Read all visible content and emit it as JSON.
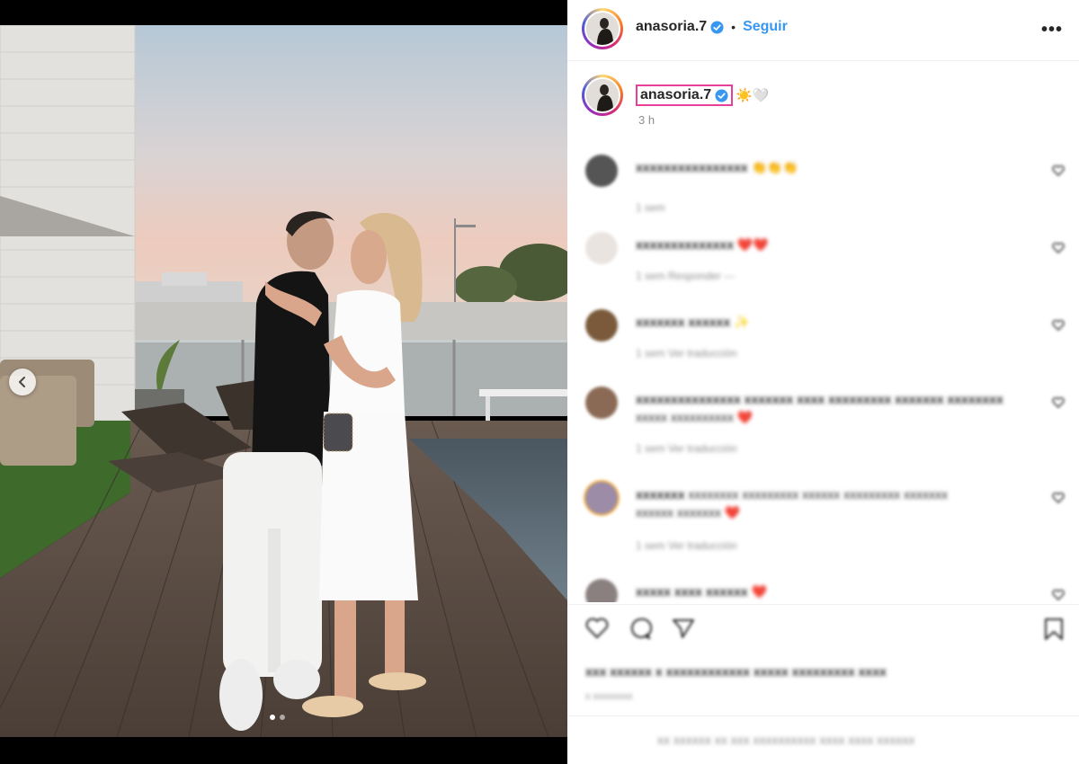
{
  "post": {
    "author": "anasoria.7",
    "follow_label": "Seguir",
    "separator": "•",
    "more_label": "•••",
    "caption_emoji": "☀️🤍",
    "time_ago": "3 h",
    "carousel": {
      "total": 2,
      "active_index": 0
    }
  },
  "comments": [
    {
      "user": "xxxxxxxxxxxxxxxx",
      "text": "",
      "emoji": "👏👏👏",
      "meta": "1 sem",
      "avatar_color": "#555555"
    },
    {
      "user": "xxxxxxxxxxxxxx",
      "text": "",
      "emoji": "❤️❤️",
      "meta": "1 sem  Responder  ---",
      "avatar_color": "#c9c4c0"
    },
    {
      "user": "xxxxxxx  xxxxxx",
      "text": "",
      "emoji": "✨",
      "meta": "1 sem  Ver traducción",
      "avatar_color": "#7a5a3a"
    },
    {
      "user": "xxxxxxxxxxxxxxx xxxxxxx xxxx xxxxxxxxx xxxxxxx xxxxxxxx",
      "text": "xxxxx xxxxxxxxxx",
      "emoji": "❤️",
      "meta": "1 sem  Ver traducción",
      "avatar_color": "#8b6a55"
    },
    {
      "user": "xxxxxxx",
      "text": "xxxxxxxx xxxxxxxxx xxxxxx xxxxxxxxx xxxxxxx",
      "text2": "xxxxxx xxxxxxx",
      "emoji": "❤️",
      "meta": "1 sem  Ver traducción",
      "avatar_color": "#9c8ca8"
    },
    {
      "user": "xxxxx xxxx xxxxxx",
      "text": "",
      "emoji": "❤️",
      "meta": "",
      "avatar_color": "#8a8080"
    }
  ],
  "footer": {
    "likes_text": "xxx xxxxxx x xxxxxxxxxxxx xxxxx xxxxxxxxx xxxx",
    "likes_time": "x xxxxxxxx",
    "add_comment_placeholder": "xx xxxxxx xx xxx xxxxxxxxxx xxxx xxxx xxxxxx"
  },
  "colors": {
    "link": "#3897f0",
    "heart": "#ed4956",
    "verified": "#3897f0",
    "highlight_box": "#e8409a"
  },
  "icons": [
    "chevron-left-icon",
    "verified-icon",
    "more-icon",
    "heart-icon",
    "comment-icon",
    "share-icon",
    "bookmark-icon"
  ]
}
